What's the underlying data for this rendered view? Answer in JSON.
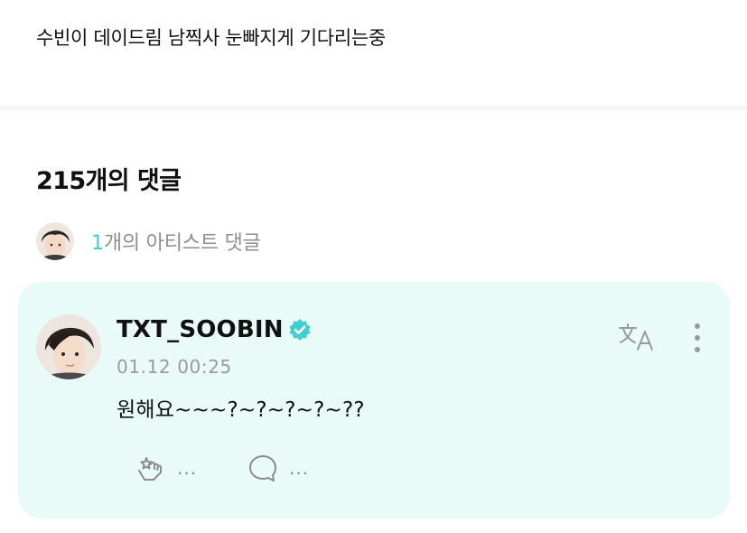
{
  "post": {
    "text": "수빈이 데이드림 남찍사 눈빠지게 기다리는중"
  },
  "comments": {
    "count_label": "215개의 댓글",
    "artist_count": "1",
    "artist_label": "개의 아티스트 댓글"
  },
  "comment": {
    "username": "TXT_SOOBIN",
    "timestamp": "01.12 00:25",
    "text": "원해요~~~?~?~?~?~??",
    "cheer_count": "...",
    "reply_count": "..."
  },
  "colors": {
    "accent": "#3fcfce",
    "card_background": "#e9fbf8",
    "verified_badge": "#3fcfce",
    "icon_gray": "#8c8c8c"
  },
  "icons": {
    "verified": "verified-badge-icon",
    "translate": "translate-icon",
    "more": "more-vertical-icon",
    "cheer": "cheer-icon",
    "reply": "reply-bubble-icon"
  }
}
